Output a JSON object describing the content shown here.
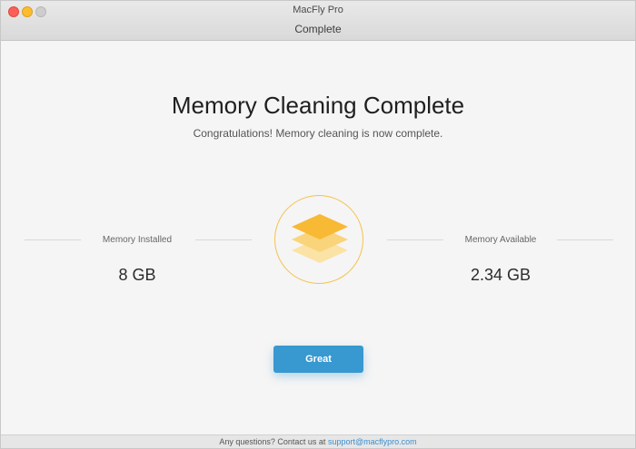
{
  "window": {
    "app_title": "MacFly Pro",
    "section_title": "Complete"
  },
  "main": {
    "heading": "Memory Cleaning Complete",
    "subheading": "Congratulations! Memory cleaning is now complete.",
    "memory_installed": {
      "label": "Memory Installed",
      "value": "8 GB"
    },
    "memory_available": {
      "label": "Memory Available",
      "value": "2.34 GB"
    },
    "great_button": "Great",
    "icon": "stacked-layers-icon"
  },
  "footer": {
    "text": "Any questions? Contact us at",
    "email": "support@macflypro.com"
  },
  "colors": {
    "accent_blue": "#3898d0",
    "icon_yellow": "#f8b934",
    "circle_border": "#f3c24c"
  }
}
